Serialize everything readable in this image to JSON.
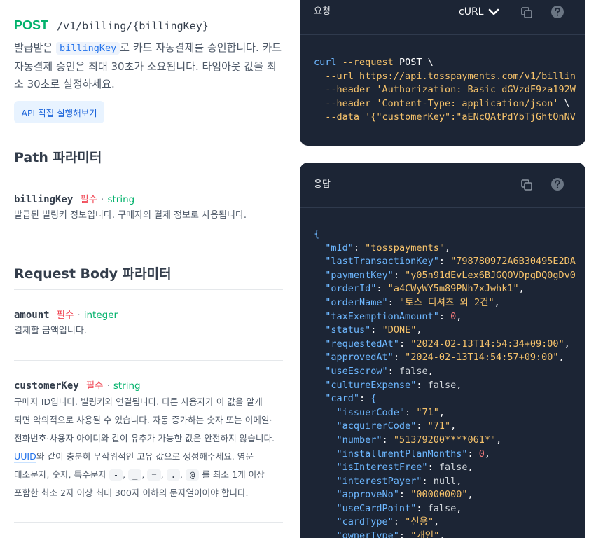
{
  "endpoint": {
    "method": "POST",
    "path": "/v1/billing/{billingKey}",
    "desc_part1": "발급받은 ",
    "desc_code": "billingKey",
    "desc_part2": "로 카드 자동결제를 승인합니다. 카드 자동결제 승인은 최대 30초가 소요됩니다. 타임아웃 값을 최소 30초로 설정하세요.",
    "try_button": "API 직접 실행해보기"
  },
  "path_params": {
    "title": "Path 파라미터",
    "items": [
      {
        "name": "billingKey",
        "required": "필수",
        "dot": "·",
        "type": "string",
        "desc": "발급된 빌링키 정보입니다. 구매자의 결제 정보로 사용됩니다."
      }
    ]
  },
  "body_params": {
    "title": "Request Body 파라미터",
    "amount": {
      "name": "amount",
      "required": "필수",
      "dot": "·",
      "type": "integer",
      "desc": "결제할 금액입니다."
    },
    "customerKey": {
      "name": "customerKey",
      "required": "필수",
      "dot": "·",
      "type": "string",
      "desc_line1": "구매자 ID입니다. 빌링키와 연결됩니다. 다른 사용자가 이 값을 알게",
      "desc_line2": "되면 악의적으로 사용될 수 있습니다. 자동 증가하는 숫자 또는 이메일·",
      "desc_line3": "전화번호·사용자 아이디와 같이 유추가 가능한 값은 안전하지 않습니다.",
      "desc_link": "UUID",
      "desc_line4_rest": "와 같이 충분히 무작위적인 고유 값으로 생성해주세요. 영문",
      "desc_line5_pre": "대소문자, 숫자, 특수문자 ",
      "chips": [
        "-",
        "_",
        "=",
        ".",
        "@"
      ],
      "comma": ",",
      "desc_line5_post": "를 최소 1개 이상",
      "desc_line6": "포함한 최소 2자 이상 최대 300자 이하의 문자열이어야 합니다."
    }
  },
  "request_panel": {
    "title": "요청",
    "language": "cURL",
    "code": {
      "cmd": "curl",
      "l1_opt": "--request",
      "l1_val": " POST \\",
      "l2_opt": "--url",
      "l2_val": " https://api.tosspayments.com/v1/billin",
      "l3_opt": "--header",
      "l3_val": " 'Authorization: Basic dGVzdF9za192W",
      "l4_opt": "--header",
      "l4_val": " 'Content-Type: application/json'",
      "l4_tail": " \\",
      "l5_opt": "--data",
      "l5_val": " '{\"customerKey\":\"aENcQAtPdYbTjGhtQnNV"
    }
  },
  "response_panel": {
    "title": "응답",
    "open_brace": "{",
    "fields": [
      {
        "key": "\"mId\"",
        "val": "\"tosspayments\"",
        "kind": "s",
        "indent": 1
      },
      {
        "key": "\"lastTransactionKey\"",
        "val": "\"798780972A6B30495E2DA",
        "kind": "s",
        "indent": 1,
        "nocomma": true
      },
      {
        "key": "\"paymentKey\"",
        "val": "\"y05n91dEvLex6BJGQOVDpgDQ0gDv0",
        "kind": "s",
        "indent": 1,
        "nocomma": true
      },
      {
        "key": "\"orderId\"",
        "val": "\"a4CWyWY5m89PNh7xJwhk1\"",
        "kind": "s",
        "indent": 1
      },
      {
        "key": "\"orderName\"",
        "val": "\"토스 티셔츠 외 2건\"",
        "kind": "s",
        "indent": 1
      },
      {
        "key": "\"taxExemptionAmount\"",
        "val": "0",
        "kind": "n",
        "indent": 1
      },
      {
        "key": "\"status\"",
        "val": "\"DONE\"",
        "kind": "s",
        "indent": 1
      },
      {
        "key": "\"requestedAt\"",
        "val": "\"2024-02-13T14:54:34+09:00\"",
        "kind": "s",
        "indent": 1
      },
      {
        "key": "\"approvedAt\"",
        "val": "\"2024-02-13T14:54:57+09:00\"",
        "kind": "s",
        "indent": 1
      },
      {
        "key": "\"useEscrow\"",
        "val": "false",
        "kind": "b",
        "indent": 1
      },
      {
        "key": "\"cultureExpense\"",
        "val": "false",
        "kind": "b",
        "indent": 1
      },
      {
        "key": "\"card\"",
        "val": "{",
        "kind": "b",
        "indent": 1,
        "nocomma": true
      },
      {
        "key": "\"issuerCode\"",
        "val": "\"71\"",
        "kind": "s",
        "indent": 2
      },
      {
        "key": "\"acquirerCode\"",
        "val": "\"71\"",
        "kind": "s",
        "indent": 2
      },
      {
        "key": "\"number\"",
        "val": "\"51379200****061*\"",
        "kind": "s",
        "indent": 2
      },
      {
        "key": "\"installmentPlanMonths\"",
        "val": "0",
        "kind": "n",
        "indent": 2
      },
      {
        "key": "\"isInterestFree\"",
        "val": "false",
        "kind": "b",
        "indent": 2
      },
      {
        "key": "\"interestPayer\"",
        "val": "null",
        "kind": "b",
        "indent": 2
      },
      {
        "key": "\"approveNo\"",
        "val": "\"00000000\"",
        "kind": "s",
        "indent": 2
      },
      {
        "key": "\"useCardPoint\"",
        "val": "false",
        "kind": "b",
        "indent": 2
      },
      {
        "key": "\"cardType\"",
        "val": "\"신용\"",
        "kind": "s",
        "indent": 2
      },
      {
        "key": "\"ownerType\"",
        "val": "\"개인\"",
        "kind": "s",
        "indent": 2
      }
    ]
  },
  "colors": {
    "method": "#03b26c",
    "required": "#f04452",
    "type": "#03b26c",
    "panel_bg": "#1c2535",
    "json_key": "#6db7ff",
    "json_string": "#f5c26b",
    "json_number": "#f77c7c"
  }
}
